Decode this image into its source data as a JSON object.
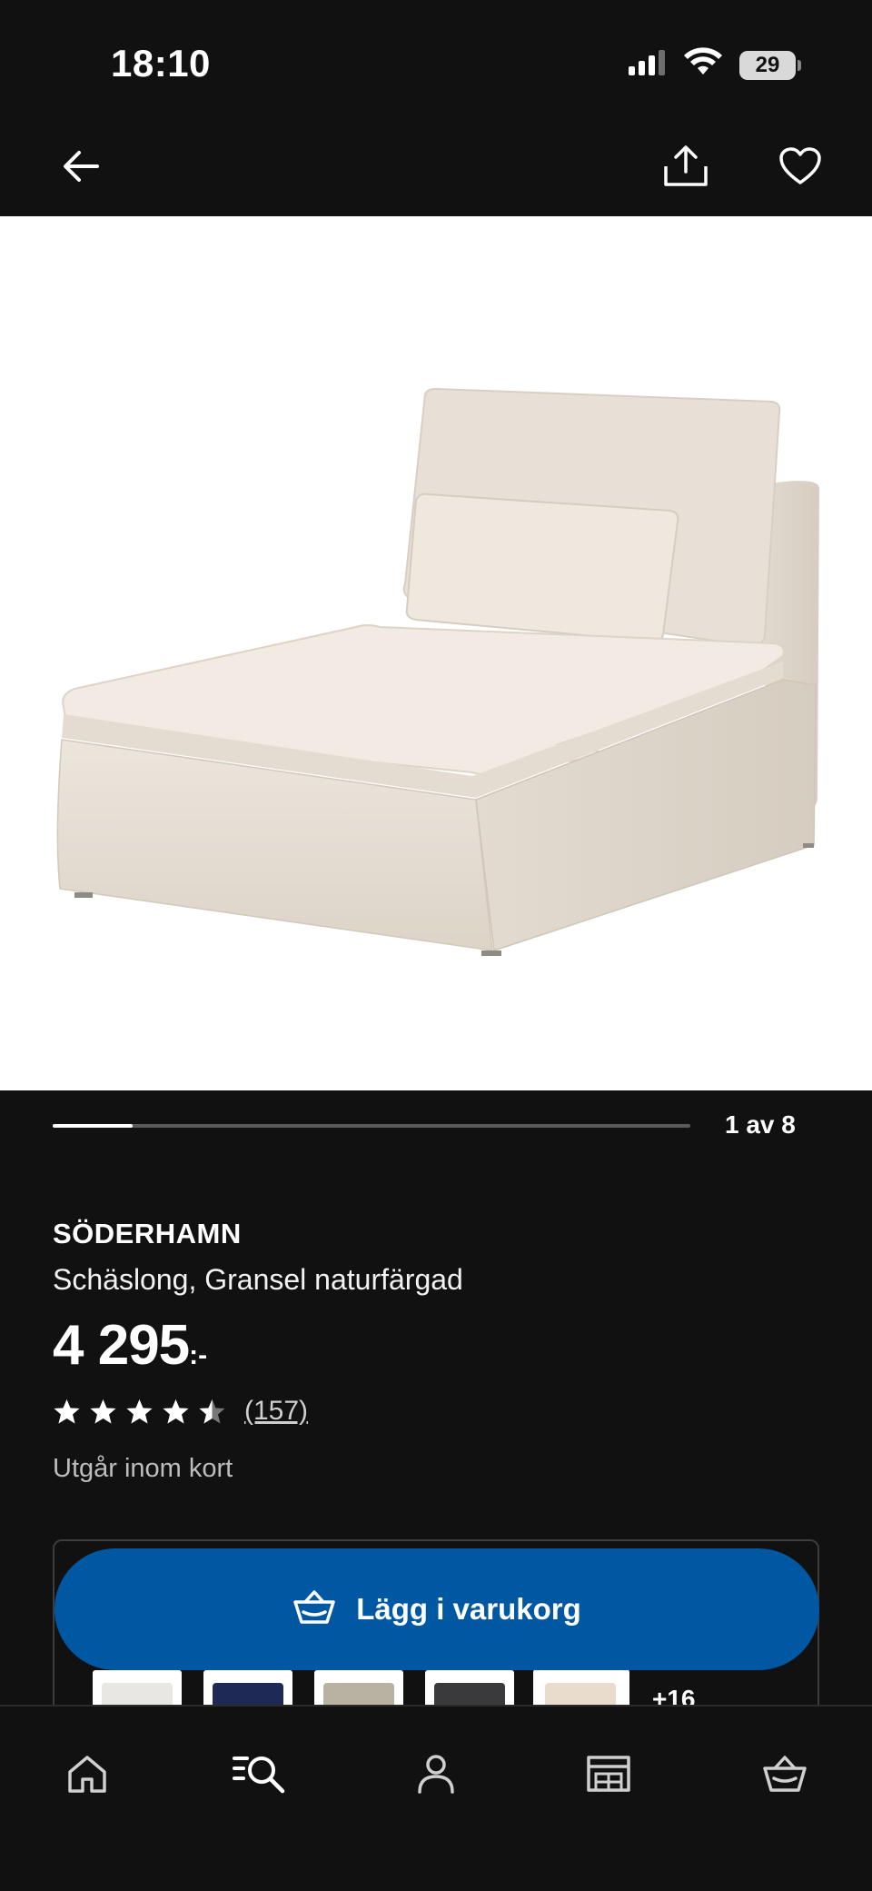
{
  "status_bar": {
    "time": "18:10",
    "battery": "29",
    "icons": [
      "signal-icon",
      "wifi-icon",
      "battery-icon"
    ]
  },
  "top_nav": {
    "icons": [
      "back-arrow-icon",
      "share-icon",
      "heart-icon"
    ]
  },
  "gallery": {
    "image": "chaise-longue-beige",
    "current": 1,
    "total": 8,
    "progress": 0.125,
    "count_label": "1 av 8"
  },
  "product": {
    "brand": "SÖDERHAMN",
    "description": "Schäslong, Gransel naturfärgad",
    "price": "4 295",
    "price_suffix": ":-",
    "rating": 4.5,
    "rating_count": "(157)",
    "availability": "Utgår inom kort"
  },
  "variants": {
    "thumbnails": [
      {
        "color": "#e9e7e3"
      },
      {
        "color": "#1e2a55"
      },
      {
        "color": "#b8b2a2"
      },
      {
        "color": "#3a3a3c"
      },
      {
        "color": "#e9dccd"
      }
    ],
    "more_label": "+16"
  },
  "cart_button": {
    "label": "Lägg i varukorg",
    "icon": "basket-icon",
    "color": "#0058a3"
  },
  "tab_bar": {
    "tabs": [
      {
        "icon": "home-icon"
      },
      {
        "icon": "search-list-icon"
      },
      {
        "icon": "profile-icon"
      },
      {
        "icon": "store-icon"
      },
      {
        "icon": "basket-icon"
      }
    ]
  }
}
